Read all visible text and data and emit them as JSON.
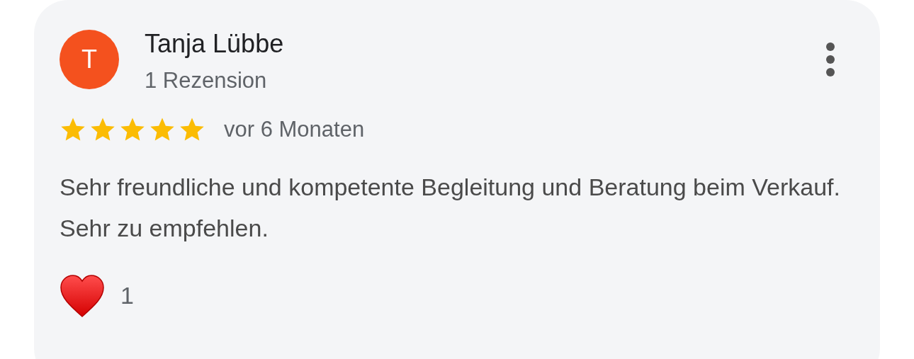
{
  "review": {
    "avatar_initial": "T",
    "author": "Tanja Lübbe",
    "review_count": "1 Rezension",
    "stars": 5,
    "time": "vor 6 Monaten",
    "text": "Sehr freundliche und kompetente Begleitung und Beratung beim Verkauf. Sehr zu empfehlen.",
    "reaction_count": "1"
  }
}
